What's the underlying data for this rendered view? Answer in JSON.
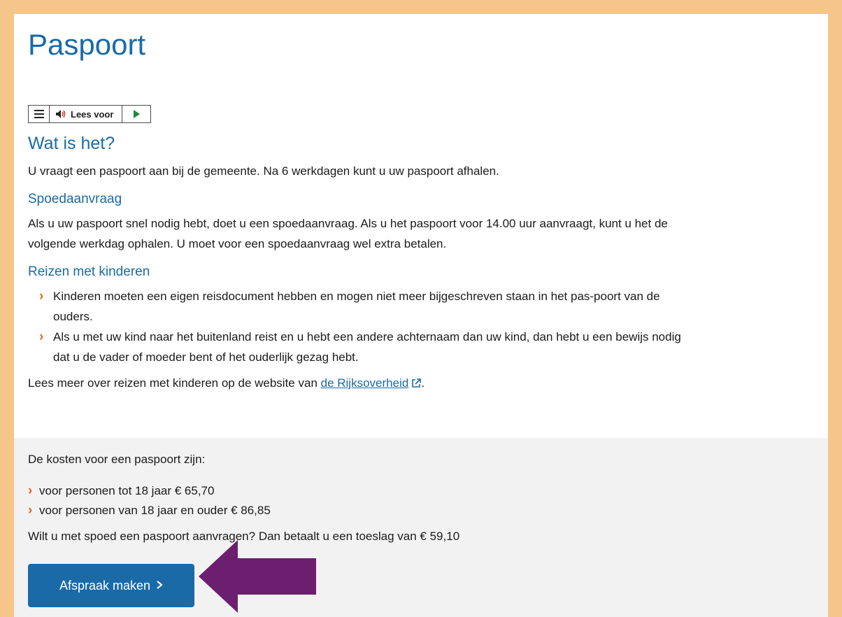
{
  "page": {
    "title": "Paspoort"
  },
  "readspeaker": {
    "listen_label": "Lees voor"
  },
  "what_is_it": {
    "heading": "Wat is het?",
    "text": "U vraagt een paspoort aan bij de gemeente. Na 6 werkdagen kunt u uw paspoort afhalen."
  },
  "urgent": {
    "heading": "Spoedaanvraag",
    "text": "Als u uw paspoort snel nodig hebt, doet u een spoedaanvraag. Als u het paspoort voor 14.00 uur aanvraagt, kunt u het de volgende werkdag ophalen. U moet voor een spoedaanvraag wel extra betalen."
  },
  "travel": {
    "heading": "Reizen met kinderen",
    "items": [
      "Kinderen moeten een eigen reisdocument hebben en mogen niet meer bijgeschreven staan in het pas-poort van de ouders.",
      "Als u met uw kind naar het buitenland reist en u hebt een andere achternaam dan uw kind, dan hebt u een bewijs nodig dat u de vader of moeder bent of het ouderlijk gezag hebt."
    ],
    "more_prefix": "Lees meer over reizen met kinderen op de website van ",
    "more_link": "de Rijksoverheid",
    "more_suffix": "."
  },
  "costs": {
    "intro": "De kosten voor een paspoort zijn:",
    "items": [
      "voor personen tot 18 jaar € 65,70",
      "voor personen van 18 jaar en ouder € 86,85"
    ],
    "urgent_note": "Wilt u met spoed een paspoort aanvragen? Dan betaalt u een toeslag van € 59,10",
    "button_label": "Afspraak maken"
  },
  "icons": {
    "chevron": "chevron-right-icon",
    "external": "external-link-icon",
    "menu": "menu-icon",
    "speaker": "speaker-icon",
    "play": "play-icon",
    "arrow": "arrow-left-icon"
  },
  "colors": {
    "frame": "#f5c58a",
    "heading_blue": "#1a6aa8",
    "chevron_orange": "#e8650f",
    "button_blue": "#1a6aa8",
    "arrow_purple": "#6b1f6e",
    "costs_bg": "#f2f2f2"
  }
}
